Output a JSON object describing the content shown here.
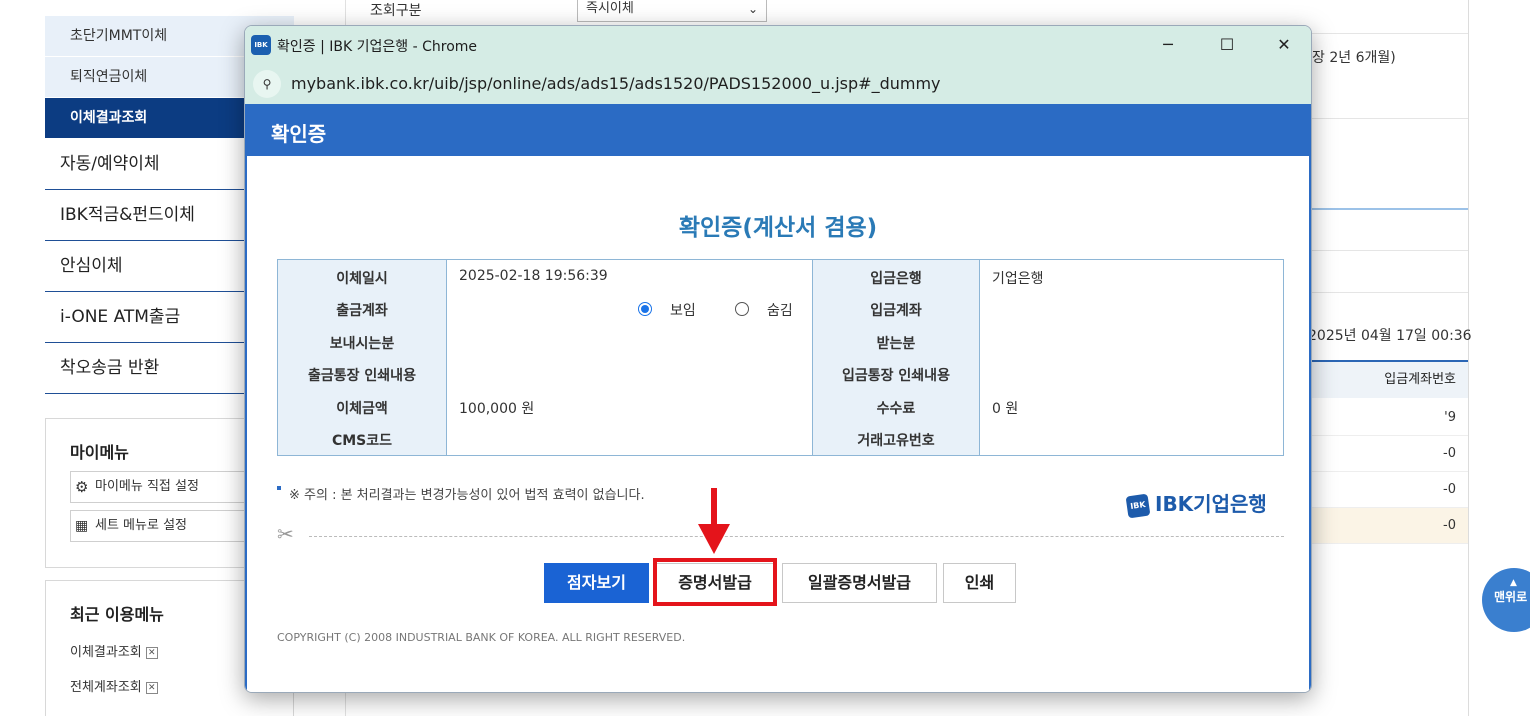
{
  "bg_sidebar": {
    "sub_items": [
      "초단기MMT이체",
      "퇴직연금이체",
      "이체결과조회"
    ],
    "nav_items": [
      "자동/예약이체",
      "IBK적금&펀드이체",
      "안심이체",
      "i-ONE ATM출금",
      "착오송금 반환"
    ],
    "mymenu_title": "마이메뉴",
    "mymenu_direct": "마이메뉴 직접 설정",
    "mymenu_set": "세트 메뉴로 설정",
    "recent_title": "최근 이용메뉴",
    "recent_items": [
      "이체결과조회",
      "전체계좌조회"
    ]
  },
  "bg_main": {
    "query_label": "조회구분",
    "query_select": "즉시이체",
    "period_note": "장 2년 6개월)",
    "date_text": "2025년 04월 17일 00:36",
    "table_header": "입금계좌번호",
    "cells": [
      "'9",
      "-0",
      "-0",
      "-0"
    ],
    "top_button": "맨위로"
  },
  "popup": {
    "window_title": "확인증 | IBK 기업은행 - Chrome",
    "logo_text": "IBK",
    "url": "mybank.ibk.co.kr/uib/jsp/online/ads/ads15/ads1520/PADS152000_u.jsp#_dummy",
    "header_title": "확인증",
    "doc_title": "확인증(계산서 겸용)",
    "labels_left": [
      "이체일시",
      "출금계좌",
      "보내시는분",
      "출금통장 인쇄내용",
      "이체금액",
      "CMS코드"
    ],
    "labels_right": [
      "입금은행",
      "입금계좌",
      "받는분",
      "입금통장 인쇄내용",
      "수수료",
      "거래고유번호"
    ],
    "transfer_datetime": "2025-02-18 19:56:39",
    "radio_show": "보임",
    "radio_hide": "숨김",
    "amount": "100,000 원",
    "deposit_bank": "기업은행",
    "fee": "0 원",
    "notice": "※ 주의 : 본 처리결과는 변경가능성이 있어 법적 효력이 없습니다.",
    "ibk_logo": "IBK기업은행",
    "buttons": {
      "braille": "점자보기",
      "issue_cert": "증명서발급",
      "bulk_issue": "일괄증명서발급",
      "print": "인쇄"
    },
    "copyright": "COPYRIGHT (C) 2008 INDUSTRIAL BANK OF KOREA. ALL RIGHT RESERVED."
  },
  "colors": {
    "brand_blue": "#2b6bc4",
    "highlight_red": "#e4141b",
    "primary_button": "#1a63d4"
  }
}
